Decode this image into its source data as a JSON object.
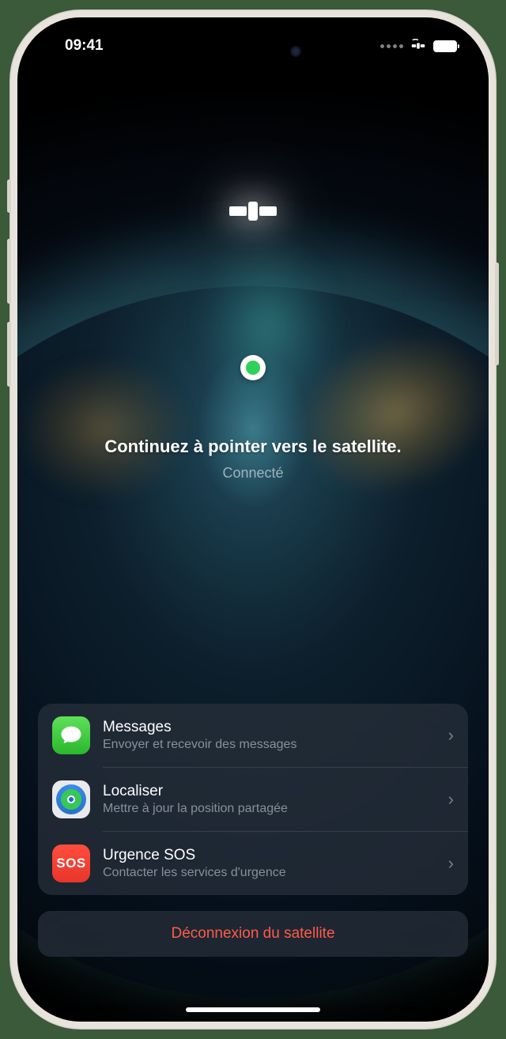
{
  "status_bar": {
    "time": "09:41"
  },
  "instruction": {
    "main": "Continuez à pointer vers le satellite.",
    "sub": "Connecté"
  },
  "options": [
    {
      "title": "Messages",
      "subtitle": "Envoyer et recevoir des messages",
      "icon": "messages"
    },
    {
      "title": "Localiser",
      "subtitle": "Mettre à jour la position partagée",
      "icon": "findmy"
    },
    {
      "title": "Urgence SOS",
      "subtitle": "Contacter les services d'urgence",
      "icon": "sos",
      "icon_text": "SOS"
    }
  ],
  "disconnect_label": "Déconnexion du satellite"
}
